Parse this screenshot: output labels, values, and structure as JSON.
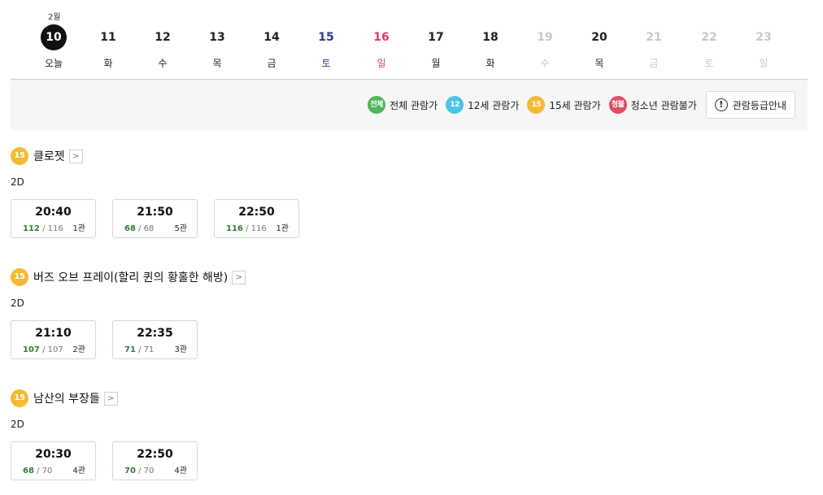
{
  "calendar": {
    "month": "2월",
    "dates": [
      {
        "num": "10",
        "day": "오늘",
        "type": "today"
      },
      {
        "num": "11",
        "day": "화",
        "type": "normal"
      },
      {
        "num": "12",
        "day": "수",
        "type": "normal"
      },
      {
        "num": "13",
        "day": "목",
        "type": "normal"
      },
      {
        "num": "14",
        "day": "금",
        "type": "normal"
      },
      {
        "num": "15",
        "day": "토",
        "type": "sat"
      },
      {
        "num": "16",
        "day": "일",
        "type": "sun"
      },
      {
        "num": "17",
        "day": "월",
        "type": "normal"
      },
      {
        "num": "18",
        "day": "화",
        "type": "normal"
      },
      {
        "num": "19",
        "day": "수",
        "type": "disabled"
      },
      {
        "num": "20",
        "day": "목",
        "type": "normal"
      },
      {
        "num": "21",
        "day": "금",
        "type": "disabled"
      },
      {
        "num": "22",
        "day": "토",
        "type": "disabled"
      },
      {
        "num": "23",
        "day": "일",
        "type": "disabled"
      }
    ]
  },
  "legend": {
    "items": [
      {
        "badge": "전체",
        "label": "전체 관람가",
        "color": "#4fb55e"
      },
      {
        "badge": "12",
        "label": "12세 관람가",
        "color": "#4cc3e8"
      },
      {
        "badge": "15",
        "label": "15세 관람가",
        "color": "#f4b935"
      },
      {
        "badge": "청불",
        "label": "청소년 관람불가",
        "color": "#e14d66"
      }
    ],
    "guide_label": "관람등급안내"
  },
  "movies": [
    {
      "rating": "15",
      "title": "클로젯",
      "format": "2D",
      "showtimes": [
        {
          "time": "20:40",
          "available": "112",
          "total": "/ 116",
          "hall": "1관"
        },
        {
          "time": "21:50",
          "available": "68",
          "total": "/ 68",
          "hall": "5관"
        },
        {
          "time": "22:50",
          "available": "116",
          "total": "/ 116",
          "hall": "1관"
        }
      ]
    },
    {
      "rating": "15",
      "title": "버즈 오브 프레이(할리 퀸의 황홀한 해방)",
      "format": "2D",
      "showtimes": [
        {
          "time": "21:10",
          "available": "107",
          "total": "/ 107",
          "hall": "2관"
        },
        {
          "time": "22:35",
          "available": "71",
          "total": "/ 71",
          "hall": "3관"
        }
      ]
    },
    {
      "rating": "15",
      "title": "남산의 부장들",
      "format": "2D",
      "showtimes": [
        {
          "time": "20:30",
          "available": "68",
          "total": "/ 70",
          "hall": "4관"
        },
        {
          "time": "22:50",
          "available": "70",
          "total": "/ 70",
          "hall": "4관"
        }
      ]
    }
  ]
}
